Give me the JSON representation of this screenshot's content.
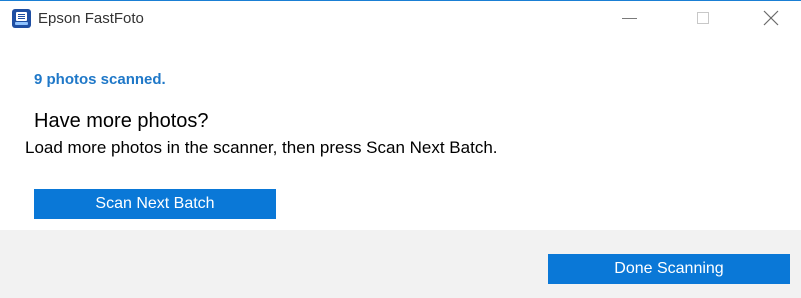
{
  "window": {
    "title": "Epson FastFoto",
    "icon": "scanner-app-icon",
    "controls": {
      "minimize_icon": "minimize-icon",
      "maximize_icon": "maximize-icon",
      "close_icon": "close-icon"
    }
  },
  "main": {
    "status": "9 photos scanned.",
    "heading": "Have more photos?",
    "instruction": "Load more photos in the scanner, then press Scan Next Batch.",
    "scan_next_label": "Scan Next Batch"
  },
  "footer": {
    "done_label": "Done Scanning"
  },
  "colors": {
    "accent": "#0a78d7",
    "status_text": "#1f78c8",
    "footer_background": "#f2f2f2"
  }
}
